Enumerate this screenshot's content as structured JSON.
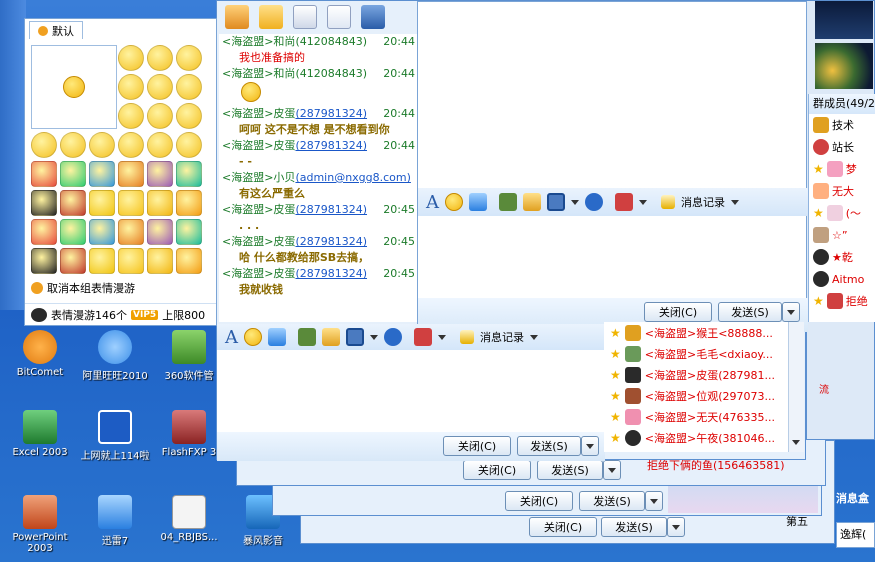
{
  "desktop_icons": [
    {
      "label": "BitComet",
      "color": "#e07a10"
    },
    {
      "label": "阿里旺旺2010",
      "color": "#3a8ee8"
    },
    {
      "label": "360软件管",
      "color": "#5aa53a"
    },
    {
      "label": "Excel 2003",
      "color": "#2a8a3a"
    },
    {
      "label": "上网就上114啦",
      "color": "#1d5cc4"
    },
    {
      "label": "FlashFXP 3",
      "color": "#b03838"
    },
    {
      "label": "PowerPoint 2003",
      "color": "#d0562a"
    },
    {
      "label": "迅雷7",
      "color": "#2a7fe0"
    },
    {
      "label": "04_RBJBS...",
      "color": "#e6e6e6"
    },
    {
      "label": "暴风影音",
      "color": "#1e88d8"
    }
  ],
  "emoji_panel": {
    "tab_label": "默认",
    "footer_action": "取消本组表情漫游",
    "status": "表情漫游146个",
    "vip_badge": "VIP5",
    "limit": "上限800",
    "preview": "preview-smiley"
  },
  "chat": {
    "messages": [
      {
        "sender": "<海盗盟>和尚",
        "qq": "(412084843)",
        "time": "20:44",
        "text": "我也准备搞的",
        "style": "red"
      },
      {
        "sender": "<海盗盟>和尚",
        "qq": "(412084843)",
        "time": "20:44",
        "text": "",
        "style": "smiley"
      },
      {
        "sender": "<海盗盟>皮蛋",
        "qq": "(287981324)",
        "time": "20:44",
        "text": "呵呵 这不是不想 是不想看到你",
        "style": "bold"
      },
      {
        "sender": "<海盗盟>皮蛋",
        "qq": "(287981324)",
        "time": "20:44",
        "text": "- -",
        "style": "bold"
      },
      {
        "sender": "<海盗盟>小贝",
        "qq": "(admin@nxgg8.com)",
        "time": "",
        "text": "有这么严重么",
        "style": "bold"
      },
      {
        "sender": "<海盗盟>皮蛋",
        "qq": "(287981324)",
        "time": "20:45",
        "text": ". . .",
        "style": "bold"
      },
      {
        "sender": "<海盗盟>皮蛋",
        "qq": "(287981324)",
        "time": "20:45",
        "text": "哈 什么都教给那SB去搞，",
        "style": "bold"
      },
      {
        "sender": "<海盗盟>皮蛋",
        "qq": "(287981324)",
        "time": "20:45",
        "text": "我就收钱",
        "style": "bold"
      }
    ]
  },
  "toolbar": {
    "history_label": "消息记录"
  },
  "buttons": {
    "close": "关闭(C)",
    "send": "发送(S)"
  },
  "members_panel": {
    "title": "群成员(49/2",
    "items": [
      "技术",
      "站长",
      "梦",
      "无大",
      "(～",
      "☆”",
      "★乾",
      "Aitmo",
      "拒绝"
    ]
  },
  "members_list2": [
    "<海盗盟>猴王<88888...",
    "<海盗盟>毛毛<dxiaoy...",
    "<海盗盟>皮蛋(287981...",
    "<海盗盟>位观(297073...",
    "<海盗盟>无天(476335...",
    "<海盗盟>午夜(381046..."
  ],
  "behind_win_text": "拒绝下俩的鱼(156463581)",
  "right_edge": {
    "tab": "逸辉(",
    "label": "第五",
    "right_label": "消息盒"
  }
}
